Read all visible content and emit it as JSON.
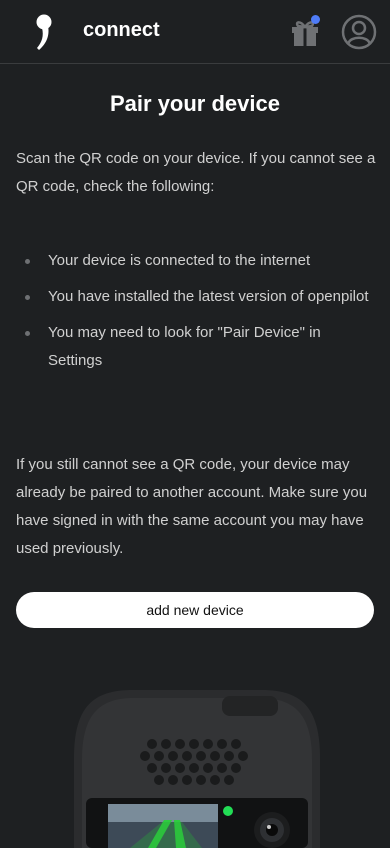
{
  "header": {
    "app_title": "connect",
    "logo_icon": "comma-logo-icon",
    "gift_icon": "gift-icon",
    "notification_color": "#4f7cf7",
    "avatar_icon": "user-circle-icon"
  },
  "main": {
    "title": "Pair your device",
    "intro": "Scan the QR code on your device. If you cannot see a QR code, check the following:",
    "checklist": [
      "Your device is connected to the internet",
      "You have installed the latest version of openpilot",
      "You may need to look for \"Pair Device\" in Settings"
    ],
    "outro": "If you still cannot see a QR code, your device may already be paired to another account. Make sure you have signed in with the same account you may have used previously.",
    "add_button_label": "add new device"
  },
  "colors": {
    "background": "#1e2022",
    "text": "#d0d0d0",
    "button_bg": "#ffffff",
    "status_led": "#22dd55"
  }
}
